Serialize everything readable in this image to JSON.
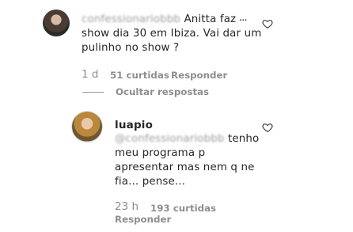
{
  "comment": {
    "username": "confessionariobbb",
    "text_line1": "Anitta faz",
    "text_line2": "show dia 30 em Ibiza. Vai dar um",
    "text_line3": "pulinho no show ?",
    "time": "1 d",
    "likes": "51 curtidas",
    "reply": "Responder",
    "more_options": "...",
    "hide_replies": "Ocultar respostas"
  },
  "reply": {
    "username": "luapio",
    "mention": "@confessionariobbb",
    "text_line1": "tenho",
    "text_line2": "meu programa p",
    "text_line3": "apresentar mas nem q ne",
    "text_line4": "fia... pense...",
    "time": "23 h",
    "likes": "193 curtidas",
    "reply_button": "Responder"
  },
  "colors": {
    "text": "#262626",
    "muted": "#8e8e8e",
    "background": "#ffffff"
  },
  "icons": {
    "like": "heart-outline-icon",
    "options": "more-options-icon"
  }
}
